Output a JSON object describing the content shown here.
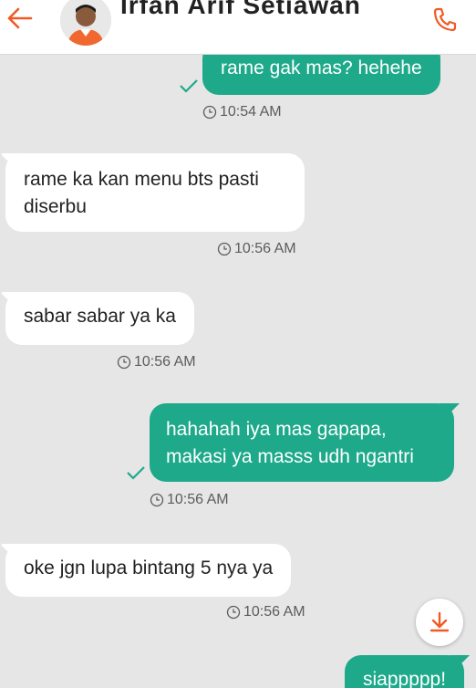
{
  "header": {
    "contact_name": "Irfan Arif Setiawan",
    "back_icon": "arrow-left-icon",
    "call_icon": "phone-icon"
  },
  "colors": {
    "accent": "#f15a24",
    "outgoing_bubble": "#1da98a",
    "incoming_bubble": "#ffffff",
    "background": "#e6e6e6",
    "check": "#1da98a"
  },
  "messages": [
    {
      "direction": "out",
      "lines": [
        "rame gak mas? hehehe"
      ],
      "time": "10:54 AM",
      "read": true
    },
    {
      "direction": "in",
      "lines": [
        "rame ka kan menu bts pasti",
        "diserbu"
      ],
      "time": "10:56 AM"
    },
    {
      "direction": "in",
      "lines": [
        "sabar sabar ya ka"
      ],
      "time": "10:56 AM"
    },
    {
      "direction": "out",
      "lines": [
        "hahahah iya mas gapapa,",
        "makasi ya masss udh ngantri"
      ],
      "time": "10:56 AM",
      "read": true
    },
    {
      "direction": "in",
      "lines": [
        "oke jgn lupa bintang 5 nya ya"
      ],
      "time": "10:56 AM"
    },
    {
      "direction": "out",
      "lines": [
        "siappppp!"
      ]
    }
  ],
  "scroll_down_icon": "download-arrow-icon"
}
